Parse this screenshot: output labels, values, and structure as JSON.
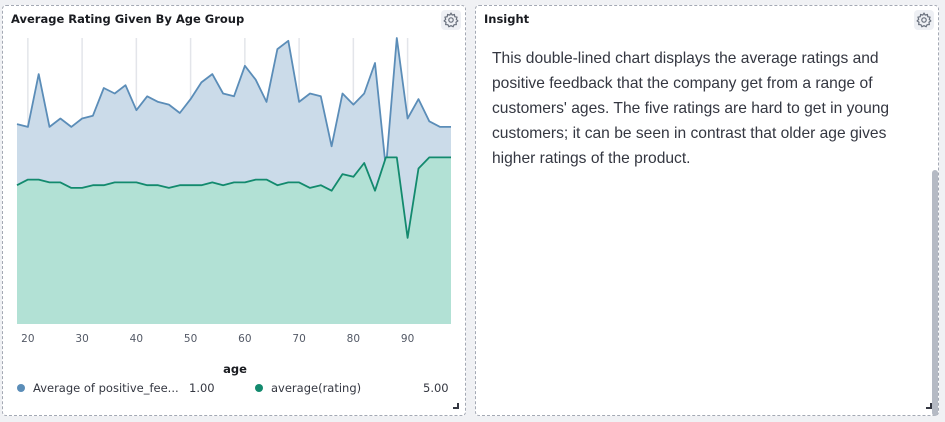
{
  "chart_panel": {
    "title": "Average Rating Given By Age Group",
    "settings_icon": "gear-icon",
    "resize_icon": "resize-handle-icon"
  },
  "insight_panel": {
    "title": "Insight",
    "settings_icon": "gear-icon",
    "text": "This double-lined chart displays the average ratings and positive feedback that the company get from a range of customers' ages. The five ratings are hard to get in young customers; it can be seen in contrast that older age gives higher ratings of the product."
  },
  "legend": {
    "items": [
      {
        "label": "Average of positive_fee...",
        "value": "1.00",
        "color": "#5b8db8"
      },
      {
        "label": "average(rating)",
        "value": "5.00",
        "color": "#138a6e"
      }
    ]
  },
  "colors": {
    "feedback_line": "#5b8db8",
    "feedback_fill": "#cbdbe9",
    "rating_line": "#138a6e",
    "rating_fill": "#b2e1d5"
  },
  "chart_data": {
    "type": "area",
    "title": "Average Rating Given By Age Group",
    "xlabel": "age",
    "ylabel": "",
    "xlim": [
      18,
      98
    ],
    "ylim": [
      0,
      5.15
    ],
    "xticks": [
      20,
      30,
      40,
      50,
      60,
      70,
      80,
      90
    ],
    "grid": true,
    "legend_position": "bottom",
    "x": [
      18,
      20,
      22,
      24,
      26,
      28,
      30,
      32,
      34,
      36,
      38,
      40,
      42,
      44,
      46,
      48,
      50,
      52,
      54,
      56,
      58,
      60,
      62,
      64,
      66,
      68,
      70,
      72,
      74,
      76,
      78,
      80,
      82,
      84,
      86,
      88,
      90,
      92,
      94,
      96,
      98
    ],
    "series": [
      {
        "name": "Average of positive_fee...",
        "values": [
          3.6,
          3.55,
          4.5,
          3.55,
          3.7,
          3.55,
          3.7,
          3.75,
          4.25,
          4.15,
          4.3,
          3.85,
          4.1,
          4.0,
          3.95,
          3.8,
          4.05,
          4.35,
          4.5,
          4.15,
          4.1,
          4.65,
          4.4,
          4.0,
          4.95,
          5.1,
          4.0,
          4.15,
          4.1,
          3.2,
          4.15,
          3.95,
          4.15,
          4.7,
          2.8,
          5.15,
          3.7,
          4.05,
          3.65,
          3.55,
          3.55
        ]
      },
      {
        "name": "average(rating)",
        "values": [
          2.5,
          2.6,
          2.6,
          2.55,
          2.55,
          2.45,
          2.45,
          2.5,
          2.5,
          2.55,
          2.55,
          2.55,
          2.5,
          2.5,
          2.45,
          2.5,
          2.5,
          2.5,
          2.55,
          2.5,
          2.55,
          2.55,
          2.6,
          2.6,
          2.5,
          2.55,
          2.55,
          2.45,
          2.5,
          2.4,
          2.7,
          2.65,
          2.9,
          2.4,
          3.0,
          3.0,
          1.55,
          2.8,
          3.0,
          3.0,
          3.0
        ]
      }
    ]
  }
}
